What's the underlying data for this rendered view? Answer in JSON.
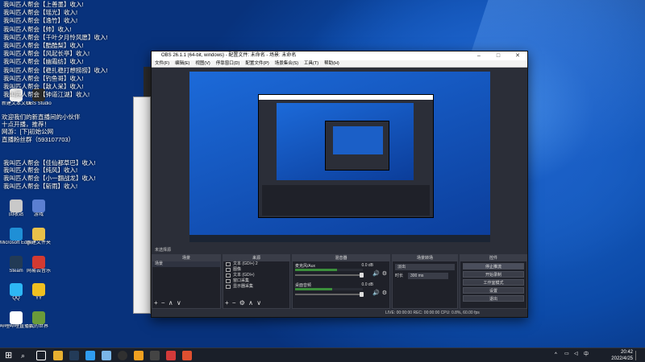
{
  "chat_overlay": [
    "我叫匹人帮会【上善墨】收入!",
    "我叫匹人帮会【瑶光】收入!",
    "我叫匹人帮会【逸竹】收入!",
    "我叫匹人帮会【帅】收入!",
    "我叫匹人帮会【千叶夕月怜风愿】收入!",
    "我叫匹人帮会【酷酷梨】收入!",
    "我叫匹人帮会【风起长亭】收入!",
    "我叫匹人帮会【幽霜纺】收入!",
    "我叫匹人帮会【稳扎稳打想捞捞】收入!",
    "我叫匹人帮会【钓鱼哥】收入!",
    "我叫匹人帮会【敌人呆】收入!",
    "我叫匹人帮会【钟道江湖】收入!",
    "欢迎我们的新直播间的小伙伴",
    "十点开播，推荐！",
    "网游：[下]初始公网",
    "直播粉丝群（593107703）",
    "我叫匹人帮会【佳仙都草巴】收入!",
    "我叫匹人帮会【纯风】收入!",
    "我叫匹人帮会【小一翻战龙】收入!",
    "我叫匹人帮会【斩雨】收入!"
  ],
  "desktop_icons": [
    {
      "label": "回收站",
      "color": "#c9c9c9"
    },
    {
      "label": "游戏",
      "color": "#5b7fd1"
    },
    {
      "label": "Microsoft Edge",
      "color": "#1f8fd6"
    },
    {
      "label": "新建文件夹",
      "color": "#e8c14a"
    },
    {
      "label": "Steam",
      "color": "#223a55"
    },
    {
      "label": "网易云音乐",
      "color": "#d33a31"
    },
    {
      "label": "QQ",
      "color": "#2db7f5"
    },
    {
      "label": "YY",
      "color": "#f0c020"
    },
    {
      "label": "哔哩哔哩直播姬",
      "color": "#ffffff"
    },
    {
      "label": "我的世界",
      "color": "#6a9b3a"
    },
    {
      "label": "新建文本文档",
      "color": "#f0f0f0"
    },
    {
      "label": "OBS Studio",
      "color": "#2a2a2a"
    }
  ],
  "obs": {
    "title": "OBS 26.1.1 (64-bit, windows) - 配置文件: 未命名 - 场景: 未命名",
    "menus": [
      "文件(F)",
      "编辑(E)",
      "视图(V)",
      "停靠窗口(D)",
      "配置文件(P)",
      "场景集合(S)",
      "工具(T)",
      "帮助(H)"
    ],
    "scene_bar_label": "未选择源",
    "docks": {
      "scenes": {
        "header": "场景",
        "items": [
          "场景"
        ]
      },
      "sources": {
        "header": "来源",
        "items": [
          "文本 (GDI+) 2",
          "图像",
          "文本 (GDI+)",
          "窗口采集",
          "显示器采集"
        ]
      },
      "mixer": {
        "header": "混音器",
        "channels": [
          {
            "name": "麦克风/Aux",
            "level": "0.0 dB",
            "fill": 0.62
          },
          {
            "name": "桌面音频",
            "level": "0.0 dB",
            "fill": 0.55
          }
        ]
      },
      "transitions": {
        "header": "场景转场",
        "type": "淡出",
        "duration_label": "时长",
        "duration": "300 ms"
      },
      "controls": {
        "header": "控件",
        "buttons": [
          "停止推流",
          "开始录制",
          "工作室模式",
          "设置",
          "退出"
        ]
      }
    },
    "status": "LIVE: 00:00:00   REC: 00:00:00   CPU: 0.8%, 60.00 fps"
  },
  "taskbar": {
    "time": "20:42",
    "date": "2022/4/25",
    "lang": "中"
  },
  "colors": {
    "obs_bg": "#2b2e38",
    "dock_bg": "#1f2129",
    "meter_green": "#3b8f3b",
    "wallpaper": "#0c4aa8"
  }
}
